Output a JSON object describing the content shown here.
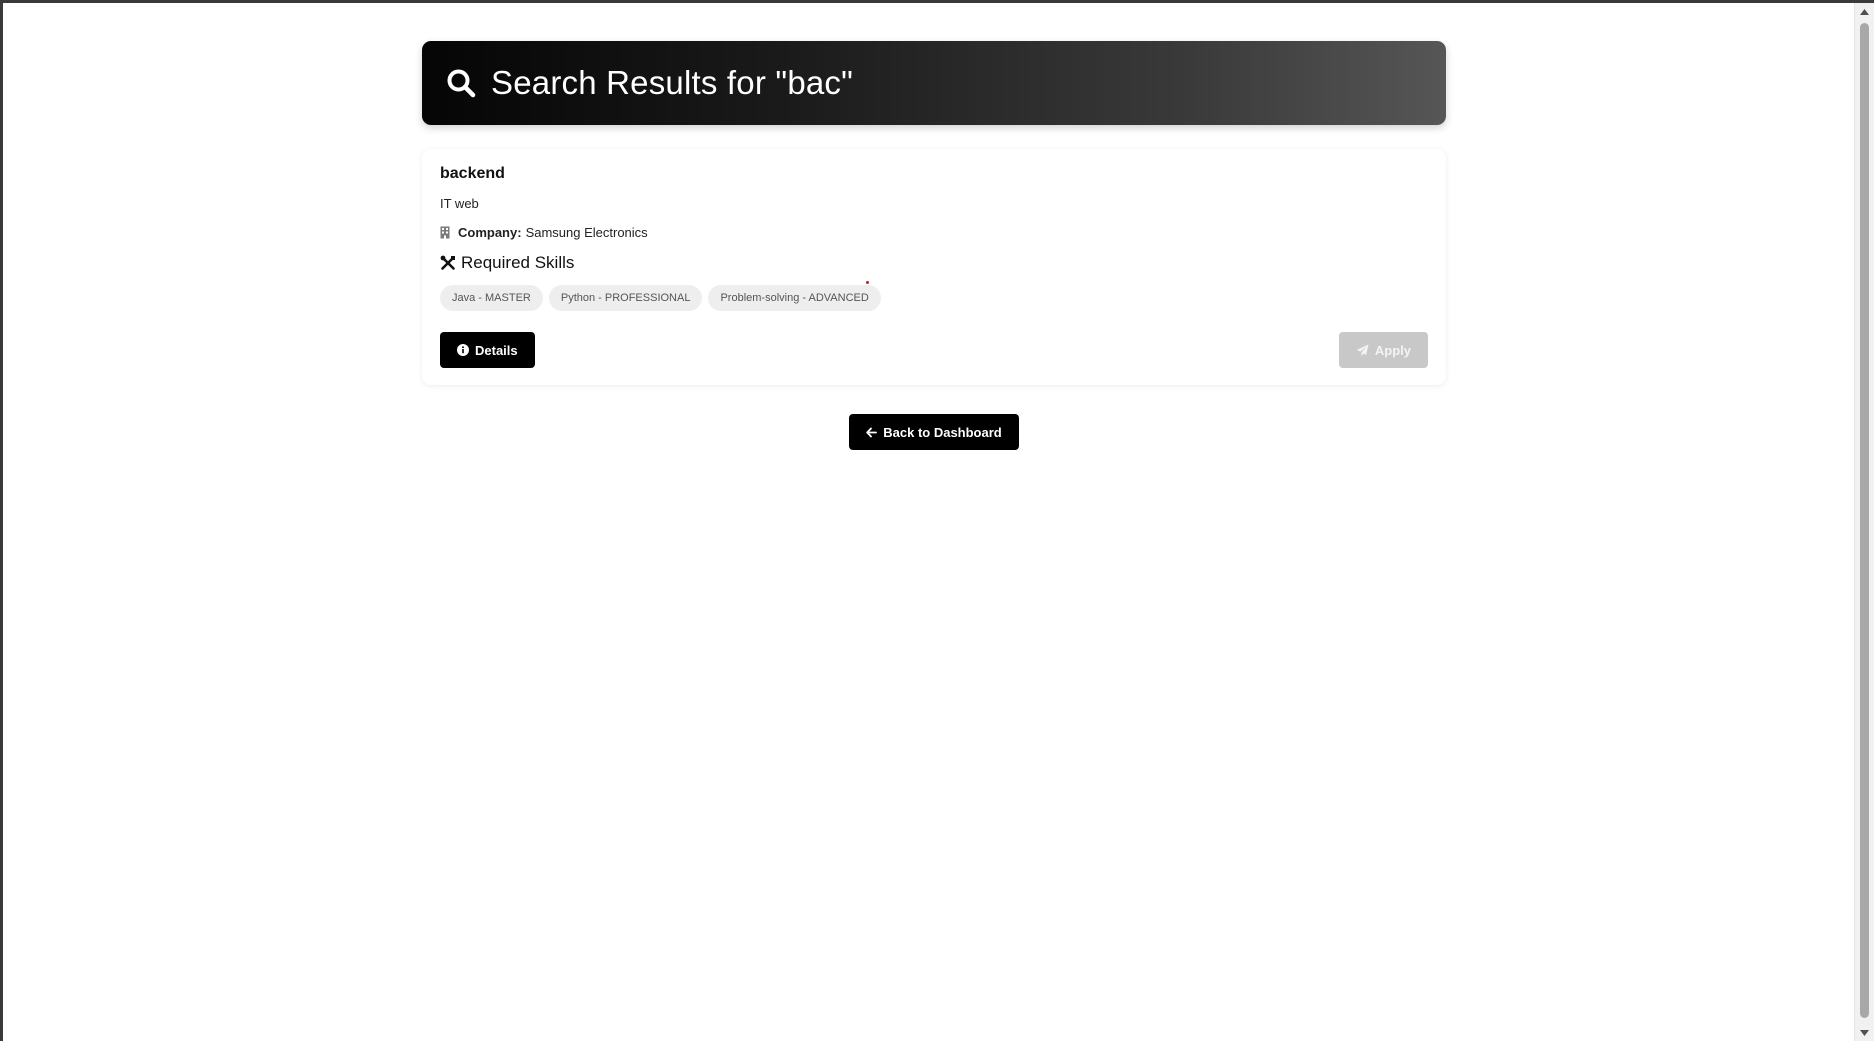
{
  "header": {
    "title": "Search Results for \"bac\"",
    "icon": "search-icon"
  },
  "results": [
    {
      "title": "backend",
      "description": "IT web",
      "company_label": "Company:",
      "company_name": "Samsung Electronics",
      "skills_heading": "Required Skills",
      "skills": [
        "Java - MASTER",
        "Python - PROFESSIONAL",
        "Problem-solving - ADVANCED"
      ],
      "details_label": "Details",
      "apply_label": "Apply",
      "apply_disabled": true
    }
  ],
  "footer": {
    "back_label": "Back to Dashboard"
  },
  "colors": {
    "primary": "#000000",
    "disabled": "#c8c8c8",
    "pill_bg": "#eeeeee"
  }
}
